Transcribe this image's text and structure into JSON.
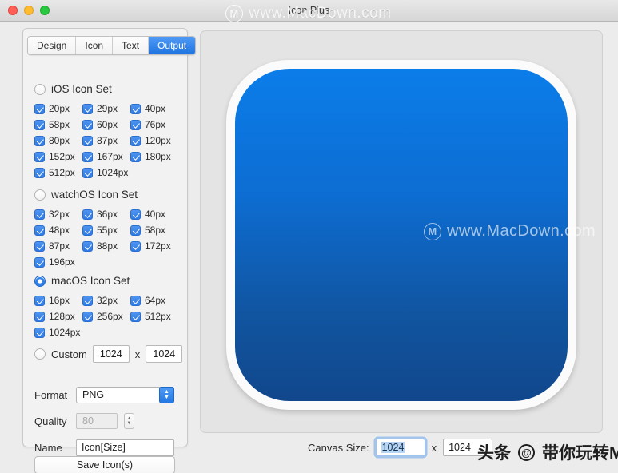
{
  "window": {
    "title": "Icon Plus",
    "traffic_lights": [
      "close",
      "minimize",
      "maximize"
    ]
  },
  "watermarks": {
    "top": "www.MacDown.com",
    "middle": "www.MacDown.com",
    "bottom_prefix": "头条",
    "bottom_at": "@",
    "bottom_suffix": "带你玩转Mac"
  },
  "tabs": [
    {
      "label": "Design",
      "active": false
    },
    {
      "label": "Icon",
      "active": false
    },
    {
      "label": "Text",
      "active": false
    },
    {
      "label": "Output",
      "active": true
    }
  ],
  "sections": [
    {
      "title": "iOS Icon Set",
      "selected": false,
      "sizes": [
        "20px",
        "29px",
        "40px",
        "58px",
        "60px",
        "76px",
        "80px",
        "87px",
        "120px",
        "152px",
        "167px",
        "180px",
        "512px",
        "1024px"
      ]
    },
    {
      "title": "watchOS Icon Set",
      "selected": false,
      "sizes": [
        "32px",
        "36px",
        "40px",
        "48px",
        "55px",
        "58px",
        "87px",
        "88px",
        "172px",
        "196px"
      ]
    },
    {
      "title": "macOS Icon Set",
      "selected": true,
      "sizes": [
        "16px",
        "32px",
        "64px",
        "128px",
        "256px",
        "512px",
        "1024px"
      ]
    }
  ],
  "custom": {
    "label": "Custom",
    "selected": false,
    "width": "1024",
    "separator": "x",
    "height": "1024"
  },
  "form": {
    "format_label": "Format",
    "format_value": "PNG",
    "quality_label": "Quality",
    "quality_value": "80",
    "name_label": "Name",
    "name_value": "Icon[Size]",
    "save_label": "Save Icon(s)"
  },
  "bottom": {
    "canvas_label": "Canvas Size:",
    "canvas_width": "1024",
    "separator": "x",
    "canvas_height": "1024"
  },
  "colors": {
    "accent": "#2f7be4",
    "tab_active": "#1f74e0",
    "icon_top": "#0b7de9",
    "icon_bottom": "#11478c"
  }
}
